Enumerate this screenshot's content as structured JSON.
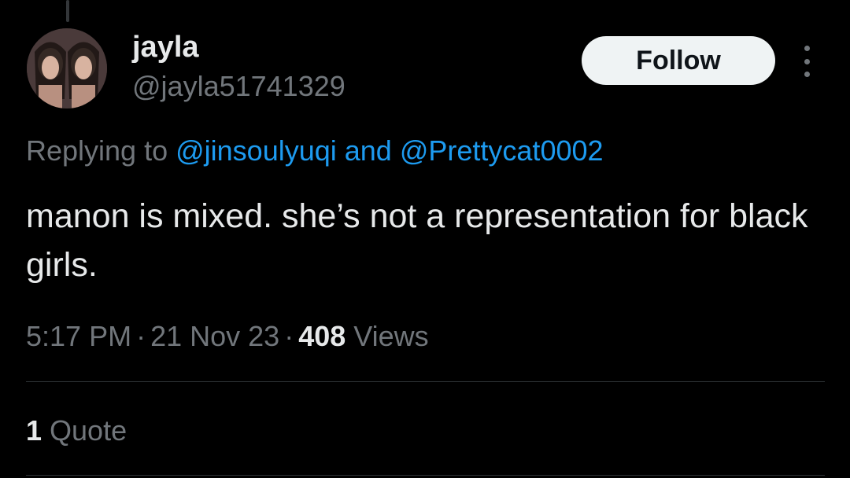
{
  "tweet": {
    "author": {
      "display_name": "jayla",
      "handle": "@jayla51741329"
    },
    "follow_label": "Follow",
    "reply": {
      "prefix": "Replying to ",
      "mention1": "@jinsoulyuqi",
      "conjunction": " and ",
      "mention2": "@Prettycat0002"
    },
    "text": "manon is mixed. she’s not a representation for black girls.",
    "time": "5:17 PM",
    "date": "21 Nov 23",
    "views_count": "408",
    "views_label": " Views",
    "separator": "·",
    "quotes_count": "1",
    "quotes_label": " Quote"
  },
  "colors": {
    "background": "#000000",
    "primary_text": "#e7e9ea",
    "secondary_text": "#71767b",
    "link": "#1d9bf0",
    "follow_bg": "#eff3f4",
    "divider": "#2f3336"
  },
  "icons": {
    "more": "more-horizontal-icon"
  }
}
